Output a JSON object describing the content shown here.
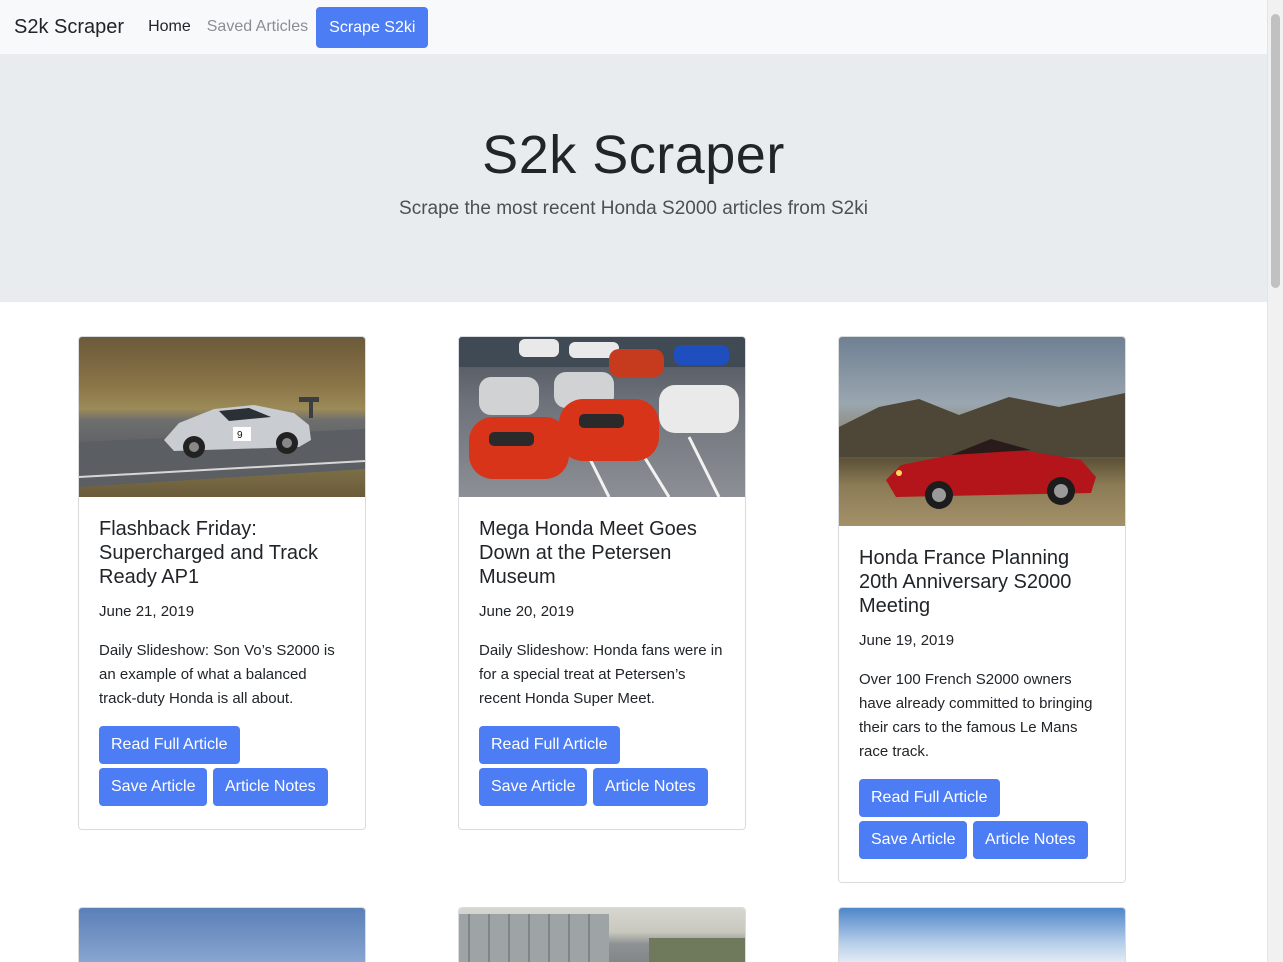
{
  "navbar": {
    "brand": "S2k Scraper",
    "links": [
      "Home",
      "Saved Articles"
    ],
    "scrape_button": "Scrape S2ki"
  },
  "hero": {
    "title": "S2k Scraper",
    "subtitle": "Scrape the most recent Honda S2000 articles from S2ki"
  },
  "articles": [
    {
      "title": "Flashback Friday: Supercharged and Track Ready AP1",
      "date": "June 21, 2019",
      "summary": "Daily Slideshow: Son Vo’s S2000 is an example of what a balanced track-duty Honda is all about.",
      "read_label": "Read Full Article",
      "save_label": "Save Article",
      "notes_label": "Article Notes",
      "image": "silver-s2000-race-car-photo"
    },
    {
      "title": "Mega Honda Meet Goes Down at the Petersen Museum",
      "date": "June 20, 2019",
      "summary": "Daily Slideshow: Honda fans were in for a special treat at Petersen’s recent Honda Super Meet.",
      "read_label": "Read Full Article",
      "save_label": "Save Article",
      "notes_label": "Article Notes",
      "image": "parking-lot-car-meet-photo"
    },
    {
      "title": "Honda France Planning 20th Anniversary S2000 Meeting",
      "date": "June 19, 2019",
      "summary": "Over 100 French S2000 owners have already committed to bringing their cars to the famous Le Mans race track.",
      "read_label": "Read Full Article",
      "save_label": "Save Article",
      "notes_label": "Article Notes",
      "image": "red-s2000-hills-photo"
    }
  ],
  "next_row_images": [
    "blue-sky-photo",
    "metal-building-photo",
    "sky-clouds-photo"
  ]
}
